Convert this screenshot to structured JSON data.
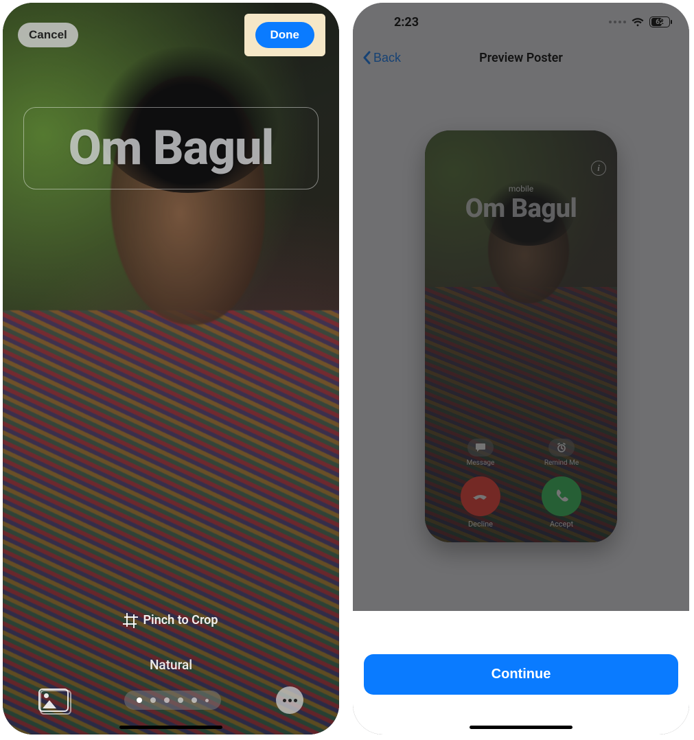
{
  "left": {
    "cancel": "Cancel",
    "done": "Done",
    "name": "Om Bagul",
    "pinch": "Pinch to Crop",
    "filter": "Natural"
  },
  "right": {
    "status": {
      "time": "2:23",
      "battery": "62"
    },
    "nav": {
      "back": "Back",
      "title": "Preview Poster"
    },
    "poster": {
      "label": "mobile",
      "name": "Om Bagul",
      "message": "Message",
      "remind": "Remind Me",
      "decline": "Decline",
      "accept": "Accept"
    },
    "continue": "Continue"
  }
}
